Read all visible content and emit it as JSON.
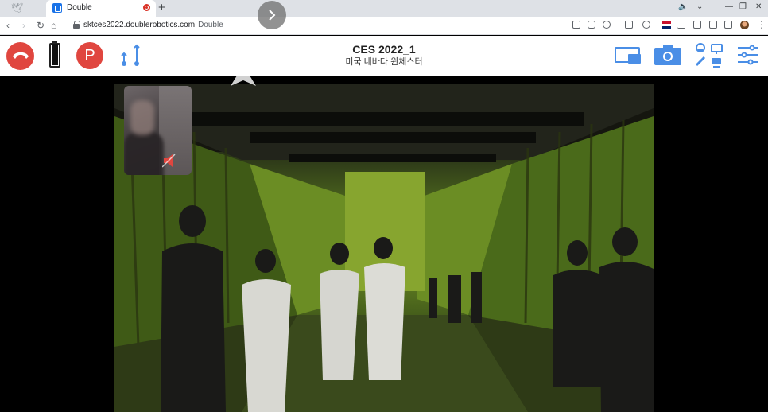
{
  "browser": {
    "tab_title": "Double",
    "new_tab_label": "+",
    "url": "sktces2022.doublerobotics.com",
    "url_suffix": "Double",
    "window_controls": [
      "—",
      "❐",
      "✕"
    ]
  },
  "toolbar": {
    "title": "CES 2022_1",
    "subtitle": "미국 네바다 윈체스터",
    "park_label": "P",
    "battery_level": 1.0,
    "colors": {
      "accent": "#4a8ee6",
      "danger": "#e0463f"
    }
  },
  "icons": {
    "end_call": "phone-hangup-icon",
    "battery": "battery-icon",
    "park": "park-icon",
    "height": "height-icon",
    "screen_share": "screen-share-icon",
    "camera": "camera-icon",
    "settings": "sliders-icon",
    "mute": "speaker-mute-icon",
    "forward": "forward-icon",
    "drive_up": "up-arrow-icon"
  }
}
